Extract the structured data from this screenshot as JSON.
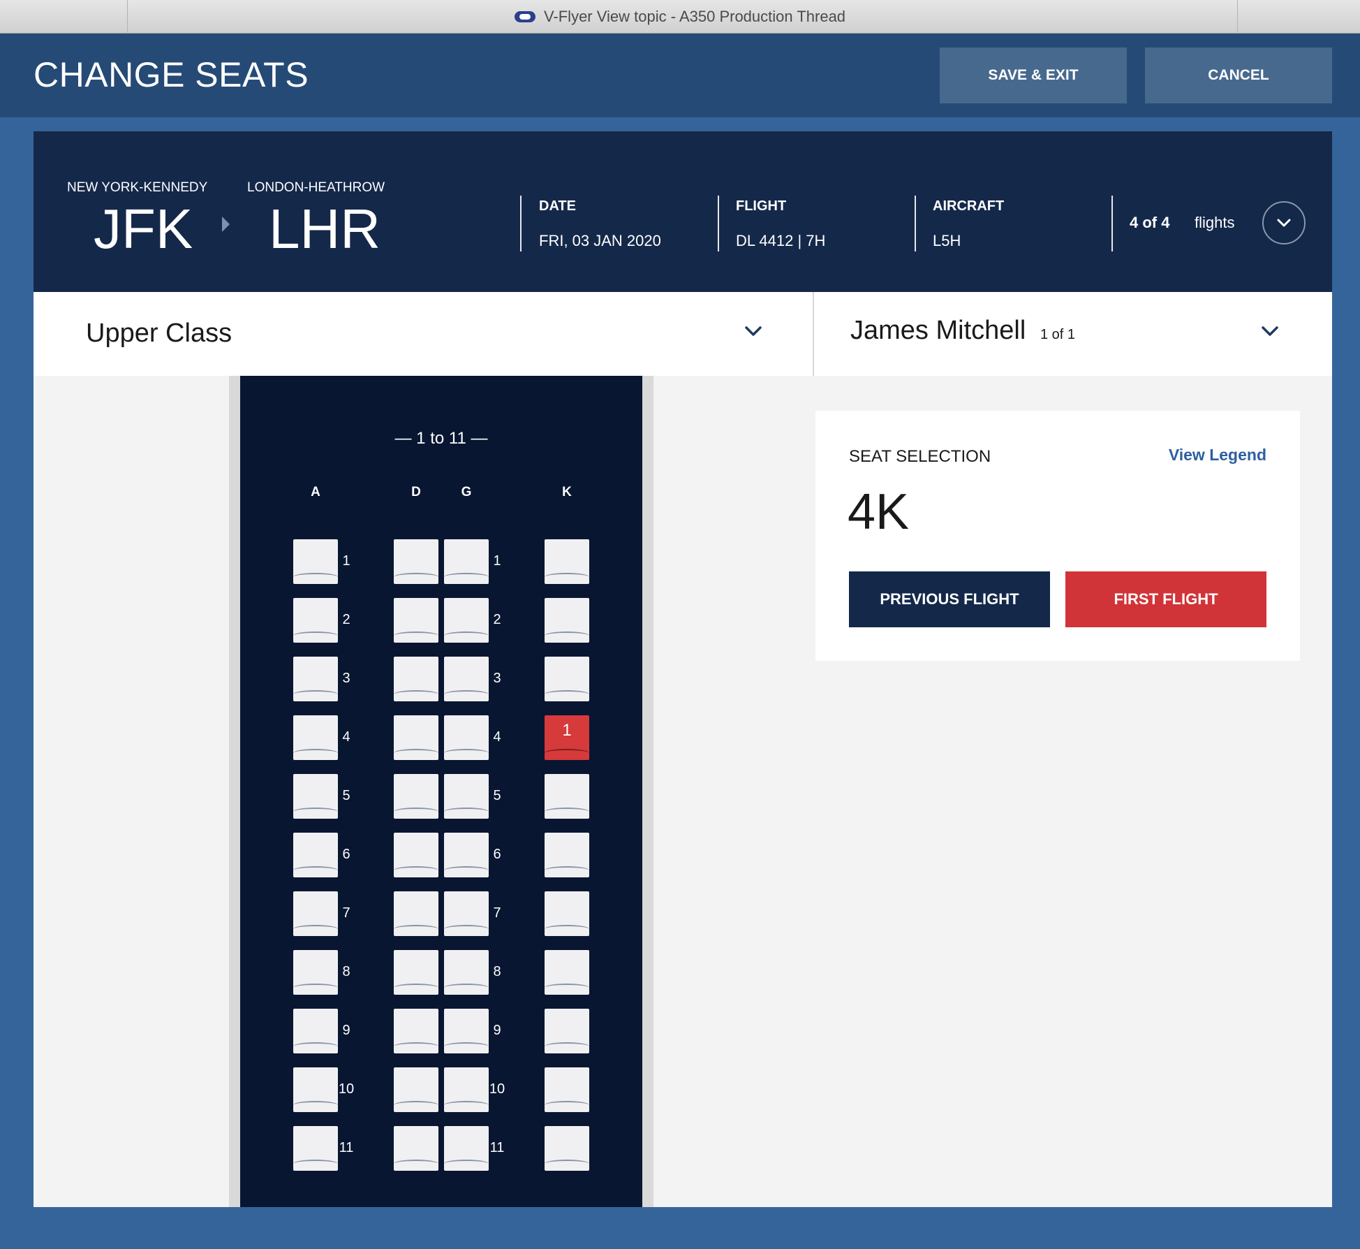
{
  "browser": {
    "tab_title": "V-Flyer View topic - A350 Production Thread"
  },
  "header": {
    "title": "CHANGE SEATS",
    "save_label": "SAVE & EXIT",
    "cancel_label": "CANCEL"
  },
  "flight": {
    "origin_city": "NEW YORK-KENNEDY",
    "origin_code": "JFK",
    "destination_city": "LONDON-HEATHROW",
    "destination_code": "LHR",
    "date_label": "DATE",
    "date_value": "FRI, 03 JAN 2020",
    "flight_label": "FLIGHT",
    "flight_value": "DL 4412 | 7H",
    "aircraft_label": "AIRCRAFT",
    "aircraft_value": "L5H",
    "flight_index": "4 of 4",
    "flights_word": "flights"
  },
  "selector": {
    "cabin": "Upper Class",
    "passenger_name": "James Mitchell",
    "passenger_count": "1 of 1"
  },
  "seatmap": {
    "section_label": "— 1 to 11 —",
    "columns": [
      "A",
      "D",
      "G",
      "K"
    ],
    "rows": [
      "1",
      "2",
      "3",
      "4",
      "5",
      "6",
      "7",
      "8",
      "9",
      "10",
      "11"
    ],
    "selected_seat": {
      "row": "4",
      "column": "K",
      "tag": "1"
    }
  },
  "selection": {
    "label": "SEAT SELECTION",
    "legend_link": "View Legend",
    "seat": "4K",
    "previous_label": "PREVIOUS FLIGHT",
    "first_label": "FIRST FLIGHT"
  },
  "colors": {
    "page_bg": "#35649a",
    "header_bg": "#254a76",
    "flight_bar_bg": "#14284a",
    "seatmap_bg": "#081631",
    "accent_red": "#d63a3a",
    "link_blue": "#2d5fa0"
  },
  "icons": {
    "favicon": "virgin-logo-icon",
    "route": "triangle-right-icon",
    "expand": "chevron-down-circle-icon",
    "dropdown": "chevron-down-icon"
  }
}
